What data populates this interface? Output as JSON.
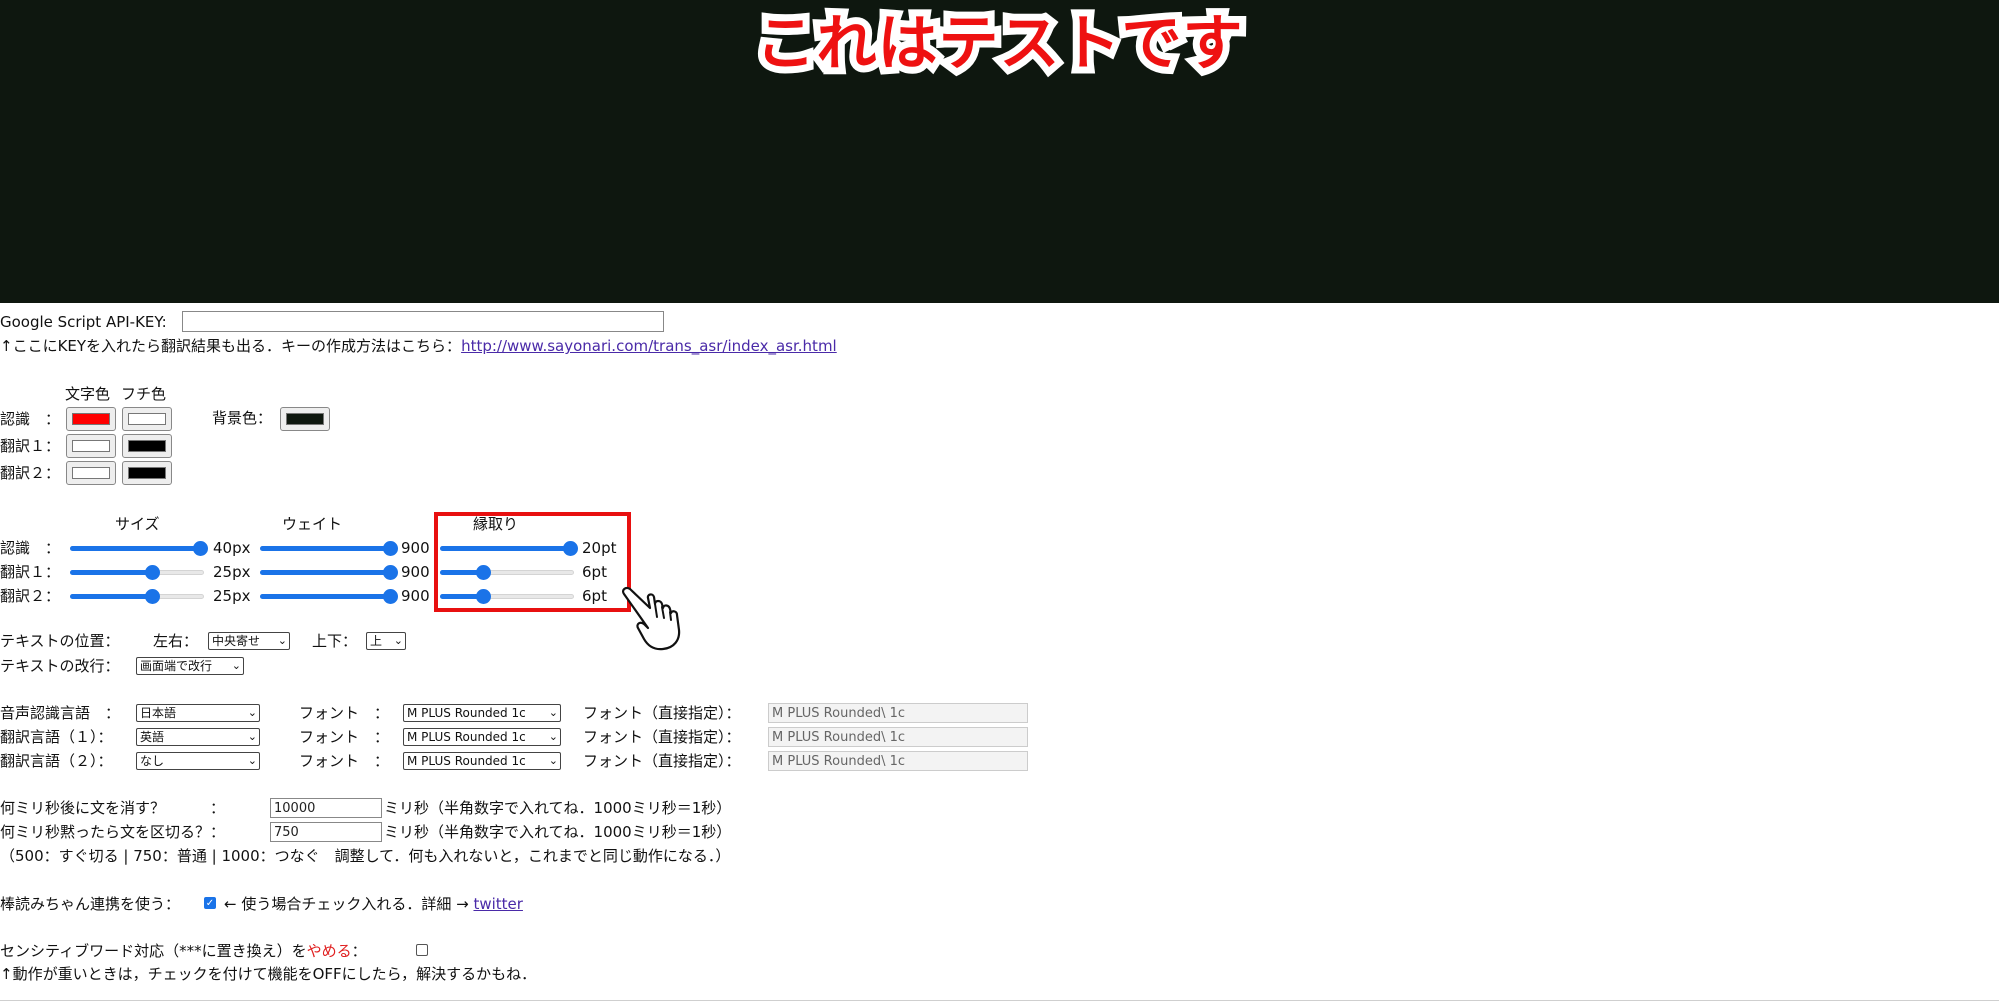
{
  "preview": {
    "text": "これはテストです",
    "text_color": "#ee1111",
    "outline_color": "#ffffff",
    "background": "#0e170f"
  },
  "api": {
    "label": "Google Script API-KEY:",
    "value": "",
    "hint": "↑ここにKEYを入れたら翻訳結果も出る．キーの作成方法はこちら：",
    "link": "http://www.sayonari.com/trans_asr/index_asr.html"
  },
  "colors": {
    "header_text": "文字色",
    "header_outline": "フチ色",
    "rows": [
      {
        "label": "認識　：",
        "text_color": "#ff0000",
        "outline_color": "#ffffff"
      },
      {
        "label": "翻訳１：",
        "text_color": "#ffffff",
        "outline_color": "#000000"
      },
      {
        "label": "翻訳２：",
        "text_color": "#ffffff",
        "outline_color": "#000000"
      }
    ],
    "bg_label": "背景色：",
    "bg_color": "#0e170f"
  },
  "sliders": {
    "header_size": "サイズ",
    "header_weight": "ウェイト",
    "header_outline": "縁取り",
    "rows": [
      {
        "label": "認識　：",
        "size": "40px",
        "size_fraction": 1.0,
        "weight": "900",
        "weight_fraction": 1.0,
        "outline": "20pt",
        "outline_fraction": 1.0
      },
      {
        "label": "翻訳１：",
        "size": "25px",
        "size_fraction": 0.62,
        "weight": "900",
        "weight_fraction": 1.0,
        "outline": "6pt",
        "outline_fraction": 0.31
      },
      {
        "label": "翻訳２：",
        "size": "25px",
        "size_fraction": 0.62,
        "weight": "900",
        "weight_fraction": 1.0,
        "outline": "6pt",
        "outline_fraction": 0.31
      }
    ]
  },
  "position": {
    "label": "テキストの位置：",
    "lr_label": "左右：",
    "lr_value": "中央寄せ",
    "ud_label": "上下：",
    "ud_value": "上",
    "wrap_label": "テキストの改行：",
    "wrap_value": "画面端で改行"
  },
  "languages": {
    "rows": [
      {
        "label": "音声認識言語　：",
        "lang": "日本語",
        "font_label": "フォント　：",
        "font": "M PLUS Rounded 1c",
        "direct_label": "フォント（直接指定）：",
        "direct": "M PLUS Rounded\\ 1c"
      },
      {
        "label": "翻訳言語（１）：",
        "lang": "英語",
        "font_label": "フォント　：",
        "font": "M PLUS Rounded 1c",
        "direct_label": "フォント（直接指定）：",
        "direct": "M PLUS Rounded\\ 1c"
      },
      {
        "label": "翻訳言語（２）：",
        "lang": "なし",
        "font_label": "フォント　：",
        "font": "M PLUS Rounded 1c",
        "direct_label": "フォント（直接指定）：",
        "direct": "M PLUS Rounded\\ 1c"
      }
    ]
  },
  "timing": {
    "erase_label": "何ミリ秒後に文を消す？　　　：",
    "erase_value": "10000",
    "erase_unit": "ミリ秒（半角数字で入れてね．1000ミリ秒＝1秒）",
    "split_label": "何ミリ秒黙ったら文を区切る？：",
    "split_value": "750",
    "split_unit": "ミリ秒（半角数字で入れてね．1000ミリ秒＝1秒）",
    "note": "（500：すぐ切る | 750：普通 | 1000：つなぐ　調整して．何も入れないと，これまでと同じ動作になる．）"
  },
  "bouyomi": {
    "label": "棒読みちゃん連携を使う：",
    "checked": true,
    "note": "← 使う場合チェック入れる．詳細 →",
    "link": "twitter"
  },
  "sensitive": {
    "label_a": "センシティブワード対応（***に置き換え）を",
    "label_red": "やめる",
    "label_b": "：",
    "checked": false,
    "note": "↑動作が重いときは，チェックを付けて機能をOFFにしたら，解決するかもね．"
  }
}
